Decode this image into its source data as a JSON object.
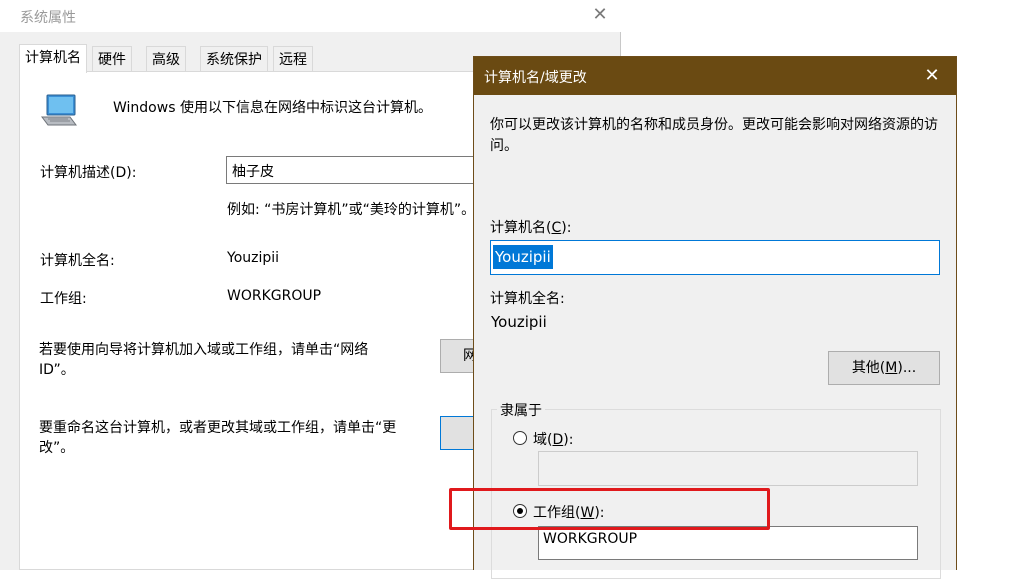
{
  "system_properties": {
    "title": "系统属性",
    "close_glyph": "✕",
    "tabs": [
      {
        "label": "计算机名",
        "active": true
      },
      {
        "label": "硬件",
        "active": false
      },
      {
        "label": "高级",
        "active": false
      },
      {
        "label": "系统保护",
        "active": false
      },
      {
        "label": "远程",
        "active": false
      }
    ],
    "intro": "Windows 使用以下信息在网络中标识这台计算机。",
    "description_label": "计算机描述(D):",
    "description_value": "柚子皮",
    "example": "例如: “书房计算机”或“美玲的计算机”。",
    "full_name_label": "计算机全名:",
    "full_name_value": "Youzipii",
    "workgroup_label": "工作组:",
    "workgroup_value": "WORKGROUP",
    "network_id_text": "若要使用向导将计算机加入域或工作组，请单击“网络ID”。",
    "network_id_button": "网",
    "rename_text": "要重命名这台计算机，或者更改其域或工作组，请单击“更改”。",
    "change_button": ""
  },
  "dialog": {
    "title": "计算机名/域更改",
    "close_glyph": "✕",
    "info": "你可以更改该计算机的名称和成员身份。更改可能会影响对网络资源的访问。",
    "computer_name_label_pre": "计算机名(",
    "computer_name_label_key": "C",
    "computer_name_label_post": "):",
    "computer_name_value": "Youzipii",
    "full_name_label": "计算机全名:",
    "full_name_value": "Youzipii",
    "other_button_pre": "其他(",
    "other_button_key": "M",
    "other_button_post": ")...",
    "member_of_label": "隶属于",
    "domain_label_pre": "域(",
    "domain_label_key": "D",
    "domain_label_post": "):",
    "domain_value": "",
    "domain_selected": false,
    "workgroup_label_pre": "工作组(",
    "workgroup_label_key": "W",
    "workgroup_label_post": "):",
    "workgroup_value": "WORKGROUP",
    "workgroup_selected": true
  },
  "colors": {
    "dialog_titlebar": "#6a4a12",
    "selection": "#0078d7",
    "highlight_box": "#e0191c"
  }
}
